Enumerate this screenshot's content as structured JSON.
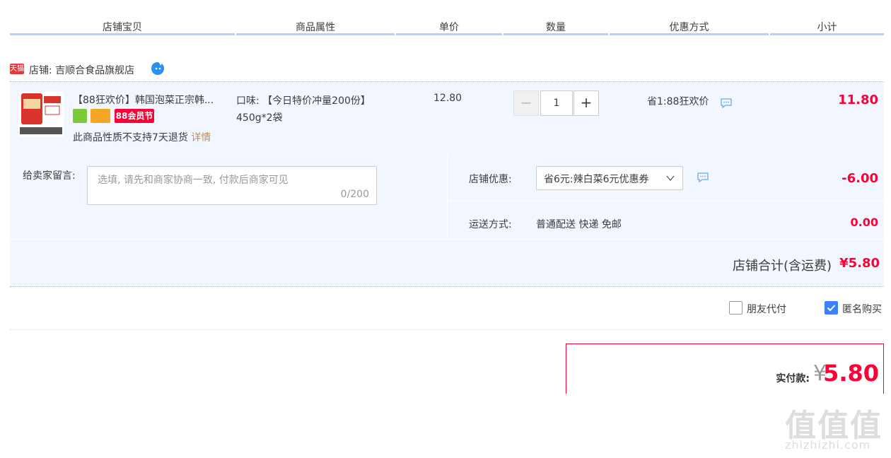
{
  "header": {
    "columns": [
      "店铺宝贝",
      "商品属性",
      "单价",
      "数量",
      "优惠方式",
      "小计"
    ]
  },
  "shop": {
    "badge": "天猫",
    "label": "店铺: 吉顺合食品旗舰店"
  },
  "item": {
    "title": "【88狂欢价】韩国泡菜正宗韩...",
    "badge_88": "88会员节",
    "no_return": "此商品性质不支持7天退货",
    "detail_link": "详情",
    "attribute": "口味: 【今日特价冲量200份】450g*2袋",
    "unit_price": "12.80",
    "quantity": "1",
    "qty_minus": "−",
    "qty_plus": "+",
    "promotion": "省1:88狂欢价",
    "subtotal": "11.80"
  },
  "message": {
    "label": "给卖家留言:",
    "placeholder": "选填, 请先和商家协商一致, 付款后商家可见",
    "counter": "0/200"
  },
  "coupon": {
    "label": "店铺优惠:",
    "selected": "省6元:辣白菜6元优惠券",
    "amount": "-6.00"
  },
  "shipping": {
    "label": "运送方式:",
    "value": "普通配送 快递 免邮",
    "amount": "0.00"
  },
  "shop_total": {
    "label": "店铺合计(含运费)",
    "value": "¥5.80"
  },
  "options": {
    "friend_pay": "朋友代付",
    "friend_pay_checked": false,
    "anonymous": "匿名购买",
    "anonymous_checked": true
  },
  "payment": {
    "label": "实付款:",
    "currency": "¥",
    "value": "5.80"
  },
  "watermark": {
    "glyphs": "值值值",
    "url": "zhizhizhi.com"
  },
  "colors": {
    "accent_red": "#ff0036",
    "header_line": "#b2d1ff",
    "row_bg": "#f2f7ff",
    "checkbox_blue": "#3d7fff"
  }
}
